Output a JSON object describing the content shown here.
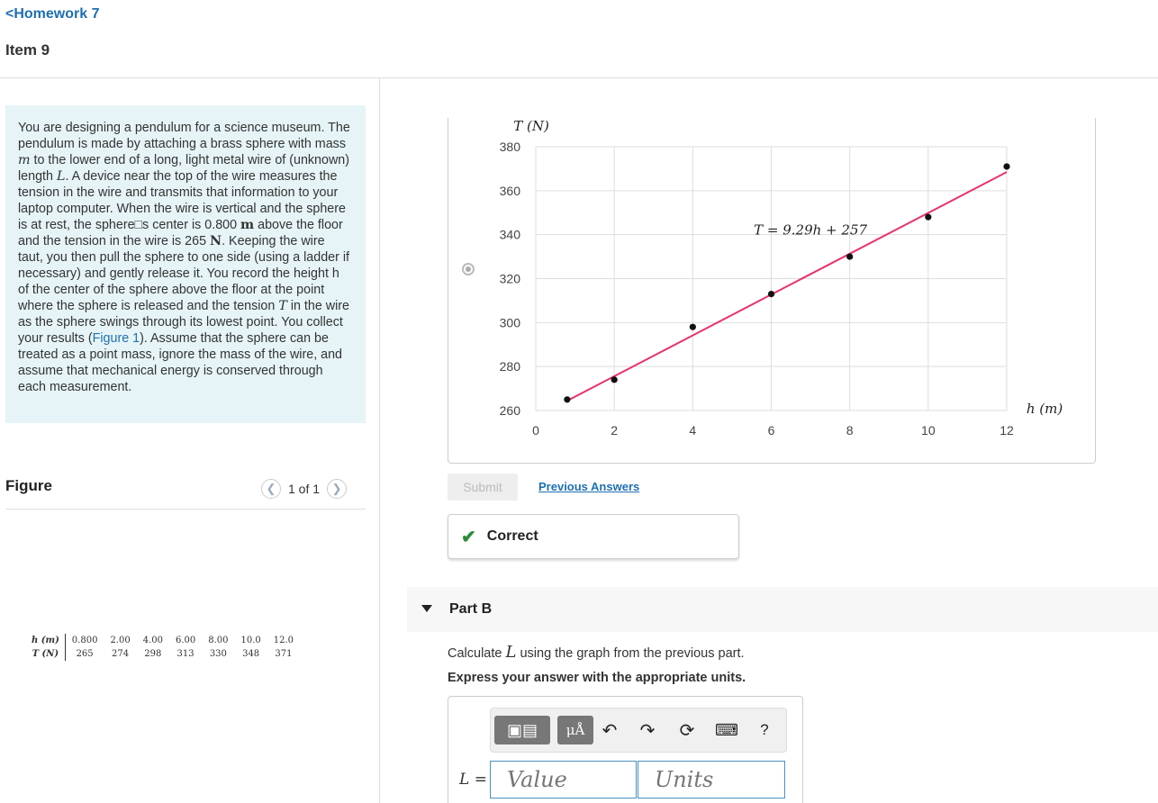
{
  "nav": {
    "back_label": "<Homework 7",
    "item_title": "Item 9"
  },
  "problem": {
    "seg1": "You are designing a pendulum for a science museum. The pendulum is made by attaching a brass sphere with mass ",
    "var_m": "m",
    "seg2": " to the lower end of a long, light metal wire of (unknown) length ",
    "var_L": "L",
    "seg3": ". A device near the top of the wire measures the tension in the wire and transmits that information to your laptop computer. When the wire is vertical and the sphere is at rest, the sphere□s center is 0.800 ",
    "unit_m": "m",
    "seg4": " above the floor and the tension in the wire is 265 ",
    "unit_N": "N",
    "seg5": ". Keeping the wire taut, you then pull the sphere to one side (using a ladder if necessary) and gently release it. You record the height h of the center of the sphere above the floor at the point where the sphere is released and the tension ",
    "var_T": "T",
    "seg6": " in the wire as the sphere swings through its lowest point. You collect your results (",
    "fig_link": "Figure 1",
    "seg7": "). Assume that the sphere can be treated as a point mass, ignore the mass of the wire, and assume that mechanical energy is conserved through each measurement."
  },
  "figure": {
    "title": "Figure",
    "pager": "1 of 1",
    "prev_icon": "chevron-left-icon",
    "next_icon": "chevron-right-icon",
    "table": {
      "row1_label": "h (m)",
      "row1": [
        "0.800",
        "2.00",
        "4.00",
        "6.00",
        "8.00",
        "10.0",
        "12.0"
      ],
      "row2_label": "T (N)",
      "row2": [
        "265",
        "274",
        "298",
        "313",
        "330",
        "348",
        "371"
      ]
    }
  },
  "chart_data": {
    "type": "scatter",
    "ylabel": "T (N)",
    "xlabel": "h (m)",
    "xlim": [
      0,
      12
    ],
    "ylim": [
      260,
      380
    ],
    "xticks": [
      "0",
      "2",
      "4",
      "6",
      "8",
      "10",
      "12"
    ],
    "yticks": [
      "380",
      "360",
      "340",
      "320",
      "300",
      "280",
      "260"
    ],
    "x": [
      0.8,
      2,
      4,
      6,
      8,
      10,
      12
    ],
    "y": [
      265,
      274,
      298,
      313,
      330,
      348,
      371
    ],
    "fit": {
      "slope": 9.29,
      "intercept": 257,
      "label": "T = 9.29h + 257"
    },
    "grid": true,
    "colors": {
      "points": "#111111",
      "fit_line": "#e8336a",
      "grid": "#dddddd"
    }
  },
  "part_a": {
    "submit_label": "Submit",
    "prev_answers": "Previous Answers",
    "correct_label": "Correct"
  },
  "part_b": {
    "title": "Part B",
    "calc_pre": "Calculate ",
    "calc_var": "L",
    "calc_post": " using the graph from the previous part.",
    "express": "Express your answer with the appropriate units.",
    "toolbar": {
      "units_label": "μÅ",
      "help_label": "?"
    },
    "answer_label": "L =",
    "value_placeholder": "Value",
    "units_placeholder": "Units"
  }
}
